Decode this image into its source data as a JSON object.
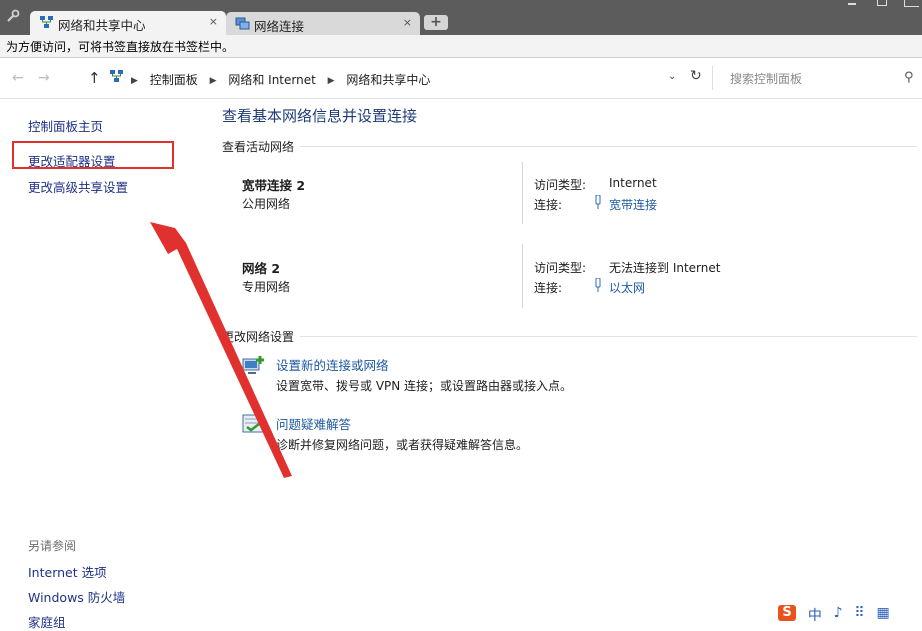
{
  "browser": {
    "tabs": [
      {
        "label": "网络和共享中心",
        "close": "×"
      },
      {
        "label": "网络连接",
        "close": "×"
      }
    ],
    "new_tab": "+",
    "bookmark_bar_text": "为方便访问，可将书签直接放在书签栏中。"
  },
  "address": {
    "back": "←",
    "forward": "→",
    "up": "↑",
    "crumbs": [
      "控制面板",
      "网络和 Internet",
      "网络和共享中心"
    ],
    "separator": "▶",
    "dropdown": "⌄",
    "refresh": "↻",
    "search_placeholder": "搜索控制面板",
    "search_icon": "⚲"
  },
  "sidebar": {
    "items": [
      "控制面板主页",
      "更改适配器设置",
      "更改高级共享设置"
    ],
    "see_also_title": "另请参阅",
    "see_also": [
      "Internet 选项",
      "Windows 防火墙",
      "家庭组"
    ]
  },
  "main": {
    "title": "查看基本网络信息并设置连接",
    "active_networks_title": "查看活动网络",
    "networks": [
      {
        "name": "宽带连接  2",
        "type": "公用网络",
        "access_label": "访问类型:",
        "access_value": "Internet",
        "conn_label": "连接:",
        "conn_value": "宽带连接"
      },
      {
        "name": "网络  2",
        "type": "专用网络",
        "access_label": "访问类型:",
        "access_value": "无法连接到 Internet",
        "conn_label": "连接:",
        "conn_value": "以太网"
      }
    ],
    "change_settings_title": "更改网络设置",
    "tasks": [
      {
        "link": "设置新的连接或网络",
        "desc": "设置宽带、拨号或 VPN 连接；或设置路由器或接入点。",
        "icon": "network-setup-icon"
      },
      {
        "link": "问题疑难解答",
        "desc": "诊断并修复网络问题，或者获得疑难解答信息。",
        "icon": "troubleshoot-icon"
      }
    ]
  },
  "tray": {
    "items": [
      "中",
      "♪",
      "⠿",
      "▦"
    ]
  },
  "colors": {
    "annotation": "#e0312f",
    "link": "#1e5aa0",
    "title": "#1e3c78"
  }
}
